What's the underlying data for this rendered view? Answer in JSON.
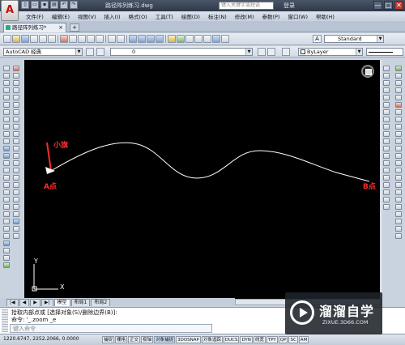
{
  "app": {
    "logo": "A",
    "title": "路径阵列练习.dwg",
    "search_placeholder": "键入关键字或短语",
    "login": "登录"
  },
  "quick_access": [
    "new-icon",
    "open-icon",
    "save-icon",
    "print-icon",
    "undo-icon",
    "redo-icon"
  ],
  "window_controls": [
    "—",
    "□",
    "✕"
  ],
  "menu": [
    "文件(F)",
    "编辑(E)",
    "视图(V)",
    "插入(I)",
    "格式(O)",
    "工具(T)",
    "绘图(D)",
    "标注(N)",
    "修改(M)",
    "参数(P)",
    "窗口(W)",
    "帮助(H)"
  ],
  "menu_controls": [
    "—",
    "□",
    "✕"
  ],
  "document_tab": {
    "label": "路径阵列练习*",
    "close": "×",
    "new": "+"
  },
  "toolbar": {
    "workspace": "AutoCAD 经典",
    "layer": "0",
    "text_style": "Standard",
    "color": "ByLayer"
  },
  "canvas": {
    "flag_label": "小旗",
    "point_a_label": "A点",
    "point_b_label": "B点",
    "ucs_y": "Y",
    "ucs_x": "X"
  },
  "layout_tabs": [
    "模型",
    "布局1",
    "布局2"
  ],
  "command": {
    "history": "拾取内部点或 [选择对象(S)/删除边界(B)]:",
    "prompt": "命令: '_.zoom _e",
    "input_placeholder": "键入命令"
  },
  "status": {
    "coords": "1220.6747, 2252.2066, 0.0000",
    "buttons": [
      "捕捉",
      "栅格",
      "正交",
      "极轴",
      "对象捕捉",
      "3DOSNAP",
      "对象追踪",
      "DUCS",
      "DYN",
      "线宽",
      "TPY",
      "QP",
      "SC",
      "AM"
    ]
  },
  "watermark": {
    "title": "溜溜自学",
    "url": "ZIXUE.3D66.COM"
  },
  "colors": {
    "canvas": "#000000",
    "label_red": "#ff2a2a",
    "curve": "#ffffff"
  }
}
